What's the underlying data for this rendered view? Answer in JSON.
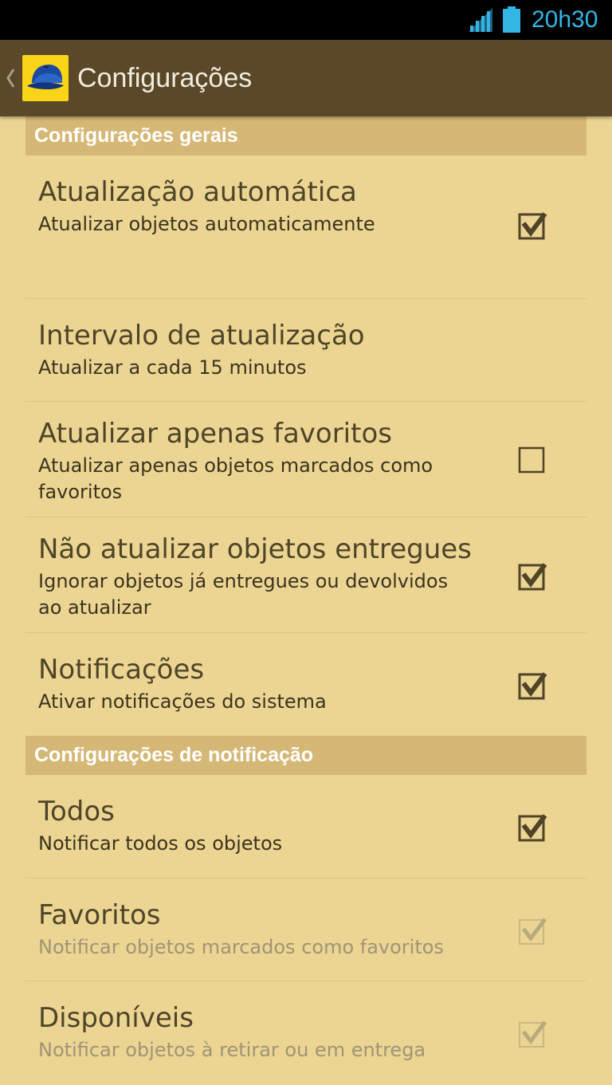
{
  "status_bar": {
    "time": "20h30"
  },
  "action_bar": {
    "title": "Configurações"
  },
  "sections": [
    {
      "header": "Configurações gerais",
      "items": [
        {
          "title": "Atualização automática",
          "summary": "Atualizar objetos automaticamente",
          "checkbox": "checked",
          "enabled": true
        },
        {
          "title": "Intervalo de atualização",
          "summary": "Atualizar a cada 15 minutos",
          "checkbox": "none",
          "enabled": true
        },
        {
          "title": "Atualizar apenas favoritos",
          "summary": "Atualizar apenas objetos marcados como favoritos",
          "checkbox": "unchecked",
          "enabled": true
        },
        {
          "title": "Não atualizar objetos entregues",
          "summary": "Ignorar objetos já entregues ou devolvidos ao atualizar",
          "checkbox": "checked",
          "enabled": true
        },
        {
          "title": "Notificações",
          "summary": "Ativar notificações do sistema",
          "checkbox": "checked",
          "enabled": true
        }
      ]
    },
    {
      "header": "Configurações de notificação",
      "items": [
        {
          "title": "Todos",
          "summary": "Notificar todos os objetos",
          "checkbox": "checked",
          "enabled": true
        },
        {
          "title": "Favoritos",
          "summary": "Notificar objetos marcados como favoritos",
          "checkbox": "checked",
          "enabled": false
        },
        {
          "title": "Disponíveis",
          "summary": "Notificar objetos à retirar ou em entrega",
          "checkbox": "checked",
          "enabled": false
        }
      ]
    }
  ],
  "colors": {
    "background": "#ecd493",
    "action_bar": "#5a4829",
    "section_header": "#d6b876",
    "clock": "#33b5e5",
    "app_icon": "#f9d417"
  }
}
